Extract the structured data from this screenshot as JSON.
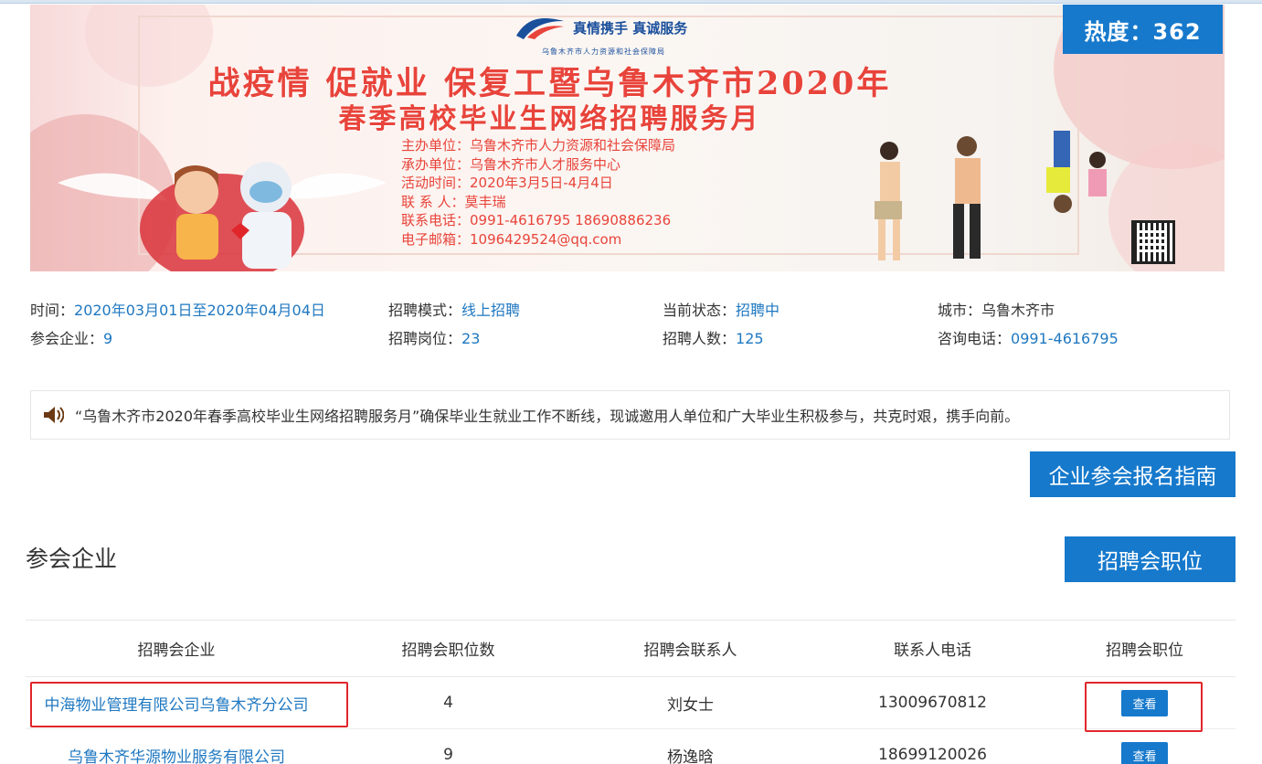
{
  "banner": {
    "logo_text": "真情携手 真诚服务",
    "logo_sub": "乌鲁木齐市人力资源和社会保障局",
    "title_line1": "战疫情 促就业 保复工暨乌鲁木齐市2020年",
    "title_line2": "春季高校毕业生网络招聘服务月",
    "lines": [
      "主办单位：乌鲁木齐市人力资源和社会保障局",
      "承办单位：乌鲁木齐市人才服务中心",
      "活动时间：2020年3月5日-4月4日",
      "联 系 人：莫丰瑞",
      "联系电话：0991-4616795  18690886236",
      "电子邮箱：1096429524@qq.com"
    ]
  },
  "heat": {
    "label": "热度：362"
  },
  "meta": {
    "time_label": "时间：",
    "time_value": "2020年03月01日至2020年04月04日",
    "mode_label": "招聘模式：",
    "mode_value": "线上招聘",
    "status_label": "当前状态：",
    "status_value": "招聘中",
    "city_label": "城市：乌鲁木齐市",
    "companies_label": "参会企业：",
    "companies_value": "9",
    "positions_label": "招聘岗位：",
    "positions_value": "23",
    "headcount_label": "招聘人数：",
    "headcount_value": "125",
    "phone_label": "咨询电话：",
    "phone_value": "0991-4616795"
  },
  "notice": {
    "text": "“乌鲁木齐市2020年春季高校毕业生网络招聘服务月”确保毕业生就业工作不断线，现诚邀用人单位和广大毕业生积极参与，共克时艰，携手向前。"
  },
  "buttons": {
    "guide": "企业参会报名指南",
    "jobs": "招聘会职位"
  },
  "section": {
    "title": "参会企业"
  },
  "table": {
    "headers": [
      "招聘会企业",
      "招聘会职位数",
      "招聘会联系人",
      "联系人电话",
      "招聘会职位"
    ],
    "rows": [
      {
        "company": "中海物业管理有限公司乌鲁木齐分公司",
        "count": "4",
        "contact": "刘女士",
        "phone": "13009670812",
        "action": "查看"
      },
      {
        "company": "乌鲁木齐华源物业服务有限公司",
        "count": "9",
        "contact": "杨逸晗",
        "phone": "18699120026",
        "action": "查看"
      }
    ]
  },
  "colors": {
    "accent": "#1679cc",
    "link": "#1f78c1",
    "highlight": "#e0262b",
    "banner_title": "#e8443b"
  }
}
